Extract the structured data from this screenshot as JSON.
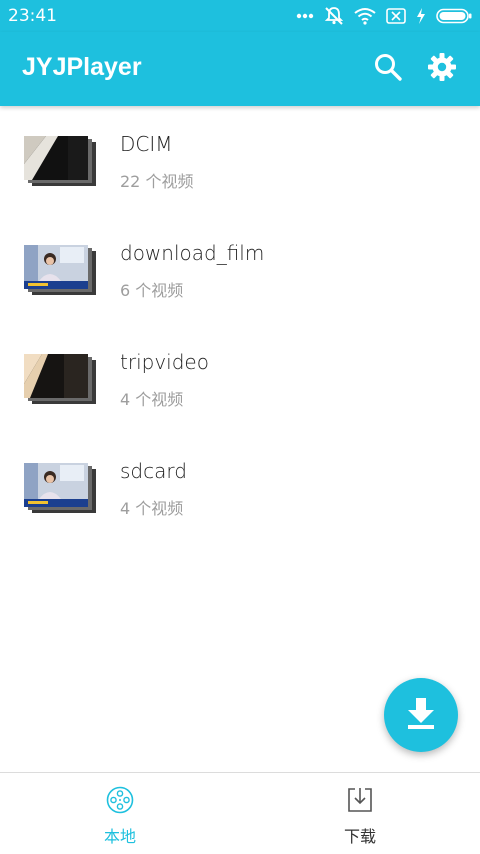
{
  "status_bar": {
    "time": "23:41",
    "icons": [
      "more-dots-icon",
      "mute-icon",
      "wifi-icon",
      "sim-card-icon",
      "charging-icon",
      "battery-icon"
    ]
  },
  "app_bar": {
    "title": "JYJPlayer",
    "icons": [
      "search-icon",
      "settings-gear-icon"
    ]
  },
  "folders": [
    {
      "name": "DCIM",
      "count_text": "22 个视频",
      "thumbnail": "dark-diagonal-video-thumb"
    },
    {
      "name": "download_film",
      "count_text": "6 个视频",
      "thumbnail": "news-anchor-video-thumb"
    },
    {
      "name": "tripvideo",
      "count_text": "4 个视频",
      "thumbnail": "dark-diagonal-video-thumb"
    },
    {
      "name": "sdcard",
      "count_text": "4 个视频",
      "thumbnail": "news-anchor-video-thumb"
    }
  ],
  "fab": {
    "icon": "download-icon"
  },
  "bottom_nav": {
    "tabs": [
      {
        "label": "本地",
        "icon": "film-reel-icon",
        "active": true
      },
      {
        "label": "下载",
        "icon": "download-tray-icon",
        "active": false
      }
    ]
  },
  "colors": {
    "primary": "#1ec0de",
    "inactive_tab": "#333333",
    "secondary_text": "#9e9e9e"
  }
}
